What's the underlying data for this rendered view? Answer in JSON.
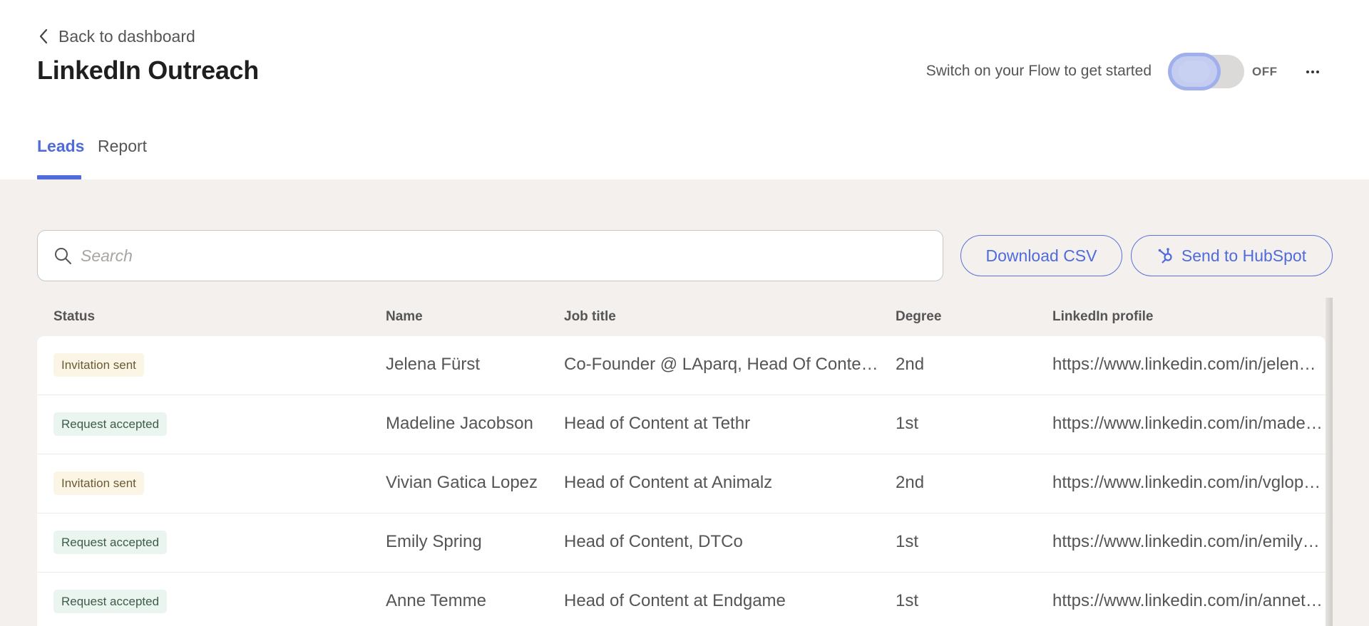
{
  "header": {
    "back_label": "Back to dashboard",
    "title": "LinkedIn Outreach",
    "flow_hint": "Switch on your Flow to get started",
    "toggle_state": "OFF"
  },
  "tabs": [
    {
      "label": "Leads",
      "active": true
    },
    {
      "label": "Report",
      "active": false
    }
  ],
  "search": {
    "placeholder": "Search",
    "value": ""
  },
  "actions": {
    "download_csv": "Download CSV",
    "send_hubspot": "Send to HubSpot"
  },
  "table": {
    "columns": [
      "Status",
      "Name",
      "Job title",
      "Degree",
      "LinkedIn profile"
    ],
    "rows": [
      {
        "status": "Invitation sent",
        "status_type": "sent",
        "name": "Jelena Fürst",
        "job": "Co-Founder @ LAparq, Head Of Conte…",
        "degree": "2nd",
        "link": "https://www.linkedin.com/in/jelena…"
      },
      {
        "status": "Request accepted",
        "status_type": "accepted",
        "name": "Madeline Jacobson",
        "job": "Head of Content at Tethr",
        "degree": "1st",
        "link": "https://www.linkedin.com/in/madeli…"
      },
      {
        "status": "Invitation sent",
        "status_type": "sent",
        "name": "Vivian Gatica Lopez",
        "job": "Head of Content at Animalz",
        "degree": "2nd",
        "link": "https://www.linkedin.com/in/vglop…"
      },
      {
        "status": "Request accepted",
        "status_type": "accepted",
        "name": "Emily Spring",
        "job": "Head of Content, DTCo",
        "degree": "1st",
        "link": "https://www.linkedin.com/in/emily…"
      },
      {
        "status": "Request accepted",
        "status_type": "accepted",
        "name": "Anne Temme",
        "job": "Head of Content at Endgame",
        "degree": "1st",
        "link": "https://www.linkedin.com/in/annet…"
      }
    ]
  },
  "colors": {
    "accent": "#4f6bdc",
    "sent_badge_bg": "#fbf5e6",
    "accepted_badge_bg": "#e9f5ee",
    "page_bg": "#f3f0ee"
  }
}
